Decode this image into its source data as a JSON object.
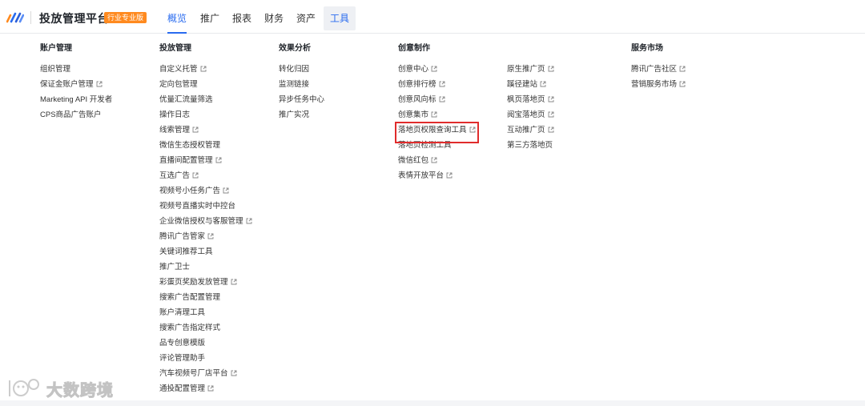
{
  "header": {
    "app_title": "投放管理平台",
    "edition_badge": "行业专业版",
    "nav": [
      {
        "label": "概览",
        "state": "active"
      },
      {
        "label": "推广",
        "state": "normal"
      },
      {
        "label": "报表",
        "state": "normal"
      },
      {
        "label": "财务",
        "state": "normal"
      },
      {
        "label": "资产",
        "state": "normal"
      },
      {
        "label": "工具",
        "state": "highlighted"
      }
    ]
  },
  "menu": {
    "account": {
      "title": "账户管理",
      "items": [
        {
          "label": "组织管理",
          "external": false
        },
        {
          "label": "保证金账户管理",
          "external": true
        },
        {
          "label": "Marketing API 开发者",
          "external": false
        },
        {
          "label": "CPS商品广告账户",
          "external": false
        }
      ]
    },
    "delivery": {
      "title": "投放管理",
      "items": [
        {
          "label": "自定义托管",
          "external": true
        },
        {
          "label": "定向包管理",
          "external": false
        },
        {
          "label": "优量汇流量筛选",
          "external": false
        },
        {
          "label": "操作日志",
          "external": false
        },
        {
          "label": "线索管理",
          "external": true
        },
        {
          "label": "微信生态授权管理",
          "external": false
        },
        {
          "label": "直播间配置管理",
          "external": true
        },
        {
          "label": "互选广告",
          "external": true
        },
        {
          "label": "视频号小任务广告",
          "external": true
        },
        {
          "label": "视频号直播实时中控台",
          "external": false
        },
        {
          "label": "企业微信授权与客服管理",
          "external": true
        },
        {
          "label": "腾讯广告管家",
          "external": true
        },
        {
          "label": "关键词推荐工具",
          "external": false
        },
        {
          "label": "推广卫士",
          "external": false
        },
        {
          "label": "彩蛋页奖励发放管理",
          "external": true
        },
        {
          "label": "搜索广告配置管理",
          "external": false
        },
        {
          "label": "账户清理工具",
          "external": false
        },
        {
          "label": "搜索广告指定样式",
          "external": false
        },
        {
          "label": "品专创意模版",
          "external": false
        },
        {
          "label": "评论管理助手",
          "external": false
        },
        {
          "label": "汽车视频号厂店平台",
          "external": true
        },
        {
          "label": "通投配置管理",
          "external": true
        }
      ]
    },
    "effect": {
      "title": "效果分析",
      "items": [
        {
          "label": "转化归因",
          "external": false
        },
        {
          "label": "监测链接",
          "external": false
        },
        {
          "label": "异步任务中心",
          "external": false
        },
        {
          "label": "推广实况",
          "external": false
        }
      ]
    },
    "creative": {
      "title": "创意制作",
      "items": [
        {
          "label": "创意中心",
          "external": true
        },
        {
          "label": "创意排行榜",
          "external": true
        },
        {
          "label": "创意风向标",
          "external": true
        },
        {
          "label": "创意集市",
          "external": true
        },
        {
          "label": "落地页权限查询工具",
          "external": true
        },
        {
          "label": "落地页检测工具",
          "external": false
        },
        {
          "label": "微信红包",
          "external": true
        },
        {
          "label": "表情开放平台",
          "external": true
        }
      ]
    },
    "landing": {
      "items": [
        {
          "label": "原生推广页",
          "external": true
        },
        {
          "label": "蹊径建站",
          "external": true
        },
        {
          "label": "枫页落地页",
          "external": true
        },
        {
          "label": "阅宝落地页",
          "external": true
        },
        {
          "label": "互动推广页",
          "external": true
        },
        {
          "label": "第三方落地页",
          "external": false
        }
      ]
    },
    "market": {
      "title": "服务市场",
      "items": [
        {
          "label": "腾讯广告社区",
          "external": true
        },
        {
          "label": "营销服务市场",
          "external": true
        }
      ]
    }
  },
  "watermark": {
    "text": "大数跨境"
  },
  "colors": {
    "accent": "#296bef",
    "badge": "#ff8a1f",
    "highlight_box": "#e02c2c"
  }
}
